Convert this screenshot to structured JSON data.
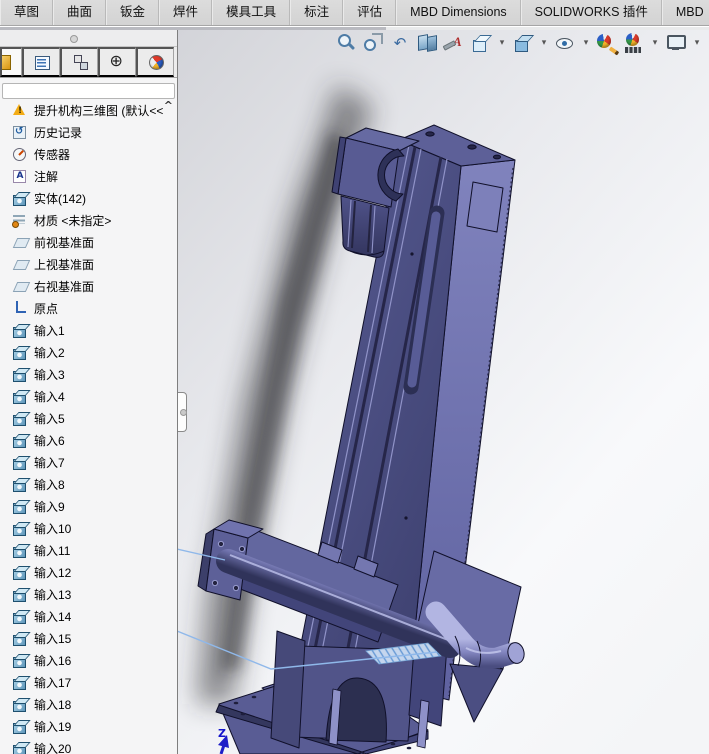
{
  "ribbon": {
    "tabs": [
      "草图",
      "曲面",
      "钣金",
      "焊件",
      "模具工具",
      "标注",
      "评估",
      "MBD Dimensions",
      "SOLIDWORKS 插件",
      "MBD"
    ]
  },
  "hud_toolbar": {
    "buttons": [
      {
        "name": "zoom-to-fit-button",
        "icon": "ico-zoomfit"
      },
      {
        "name": "zoom-to-area-button",
        "icon": "ico-zoomarea"
      },
      {
        "name": "previous-view-button",
        "icon": "ico-prevview",
        "glyph": "↶"
      },
      {
        "name": "section-view-button",
        "icon": "ico-section"
      },
      {
        "name": "dynamic-annotation-views-button",
        "icon": "ico-annoviews"
      },
      {
        "name": "view-orientation-button",
        "icon": "ico-vieworient"
      },
      {
        "name": "view-orientation-dropdown",
        "icon": "ico-caret",
        "glyph": "▾"
      },
      {
        "name": "display-style-button",
        "icon": "ico-dispstyle"
      },
      {
        "name": "display-style-dropdown",
        "icon": "ico-caret",
        "glyph": "▾"
      },
      {
        "name": "hide-show-items-button",
        "icon": "ico-hideshow"
      },
      {
        "name": "hide-show-items-dropdown",
        "icon": "ico-caret",
        "glyph": "▾"
      },
      {
        "name": "edit-appearance-button",
        "icon": "ico-appearance"
      },
      {
        "name": "apply-scene-button",
        "icon": "ico-scene"
      },
      {
        "name": "apply-scene-dropdown",
        "icon": "ico-caret",
        "glyph": "▾"
      },
      {
        "name": "view-settings-button",
        "icon": "ico-viewsettings"
      },
      {
        "name": "view-settings-dropdown",
        "icon": "ico-caret",
        "glyph": "▾"
      }
    ]
  },
  "left_panel": {
    "manager_tabs": [
      {
        "name": "featuremanager-tree-tab",
        "icon": "tab-feature-icon",
        "state": "active"
      },
      {
        "name": "propertymanager-tab",
        "icon": "tab-props-icon",
        "state": ""
      },
      {
        "name": "configurationmanager-tab",
        "icon": "tab-config-icon",
        "state": ""
      },
      {
        "name": "dimxpertmanager-tab",
        "icon": "tab-dimxpert-icon",
        "state": ""
      },
      {
        "name": "displaymanager-tab",
        "icon": "tab-display-icon",
        "state": ""
      }
    ],
    "filter": {
      "value": "",
      "placeholder": ""
    },
    "scroll_up_glyph": "^",
    "tree": {
      "root": {
        "icon": "warning-icon",
        "label": "提升机构三维图 (默认<<"
      },
      "items": [
        {
          "icon": "history-icon",
          "label": "历史记录"
        },
        {
          "icon": "sensor-icon",
          "label": "传感器"
        },
        {
          "icon": "note-icon",
          "label": "注解"
        },
        {
          "icon": "bodies-icon",
          "label": "实体(142)"
        },
        {
          "icon": "material-icon",
          "label": "材质 <未指定>"
        },
        {
          "icon": "plane-icon",
          "label": "前视基准面"
        },
        {
          "icon": "plane-icon",
          "label": "上视基准面"
        },
        {
          "icon": "plane-icon",
          "label": "右视基准面"
        },
        {
          "icon": "origin-icon",
          "label": "原点"
        },
        {
          "icon": "cube-icon",
          "label": "输入1"
        },
        {
          "icon": "cube-icon",
          "label": "输入2"
        },
        {
          "icon": "cube-icon",
          "label": "输入3"
        },
        {
          "icon": "cube-icon",
          "label": "输入4"
        },
        {
          "icon": "cube-icon",
          "label": "输入5"
        },
        {
          "icon": "cube-icon",
          "label": "输入6"
        },
        {
          "icon": "cube-icon",
          "label": "输入7"
        },
        {
          "icon": "cube-icon",
          "label": "输入8"
        },
        {
          "icon": "cube-icon",
          "label": "输入9"
        },
        {
          "icon": "cube-icon",
          "label": "输入10"
        },
        {
          "icon": "cube-icon",
          "label": "输入11"
        },
        {
          "icon": "cube-icon",
          "label": "输入12"
        },
        {
          "icon": "cube-icon",
          "label": "输入13"
        },
        {
          "icon": "cube-icon",
          "label": "输入14"
        },
        {
          "icon": "cube-icon",
          "label": "输入15"
        },
        {
          "icon": "cube-icon",
          "label": "输入16"
        },
        {
          "icon": "cube-icon",
          "label": "输入17"
        },
        {
          "icon": "cube-icon",
          "label": "输入18"
        },
        {
          "icon": "cube-icon",
          "label": "输入19"
        },
        {
          "icon": "cube-icon",
          "label": "输入20"
        }
      ]
    }
  },
  "viewport": {
    "triad": {
      "z_label": "Z"
    },
    "model": {
      "name": "提升机构三维图",
      "front_color": "#565a92",
      "side_color": "#7f82bc",
      "edge_color": "#10102a",
      "highlight_color": "#9093c8",
      "selection_color": "#8fb8ea"
    }
  }
}
